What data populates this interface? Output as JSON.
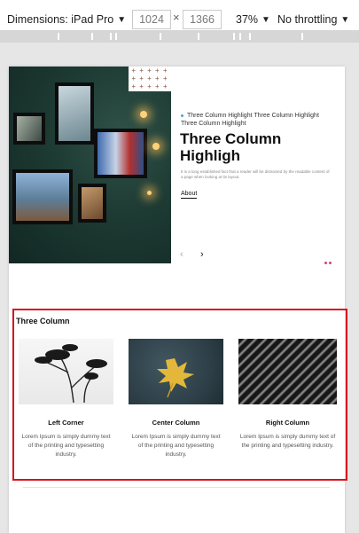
{
  "toolbar": {
    "dimensions_label": "Dimensions: iPad Pro",
    "width": "1024",
    "height": "1366",
    "times": "×",
    "zoom": "37%",
    "throttle": "No throttling"
  },
  "hero": {
    "eyebrow": "Three Column Highlight Three Column Highlight Three Column Highlight",
    "title": "Three Column Highligh",
    "description": "It is a long established fact that a reader will be distracted by the readable content of a page when looking at its layout.",
    "link": "About",
    "pattern": "+ + + + + + + + + + + + + + + + + + + + + + + + +"
  },
  "section": {
    "title": "Three Column",
    "columns": [
      {
        "name": "Left Corner",
        "text": "Lorem Ipsum is simply dummy text of the printing and typesetting industry."
      },
      {
        "name": "Center Column",
        "text": "Lorem Ipsum is simply dummy text of the printing and typesetting industry."
      },
      {
        "name": "Right Column",
        "text": "Lorem Ipsum is simply dummy text of the printing and typesetting industry."
      }
    ]
  },
  "colors": {
    "highlight_outline": "#d9121d",
    "hero_bg": "#1d3a33",
    "slider_dot": "#d6456a"
  }
}
